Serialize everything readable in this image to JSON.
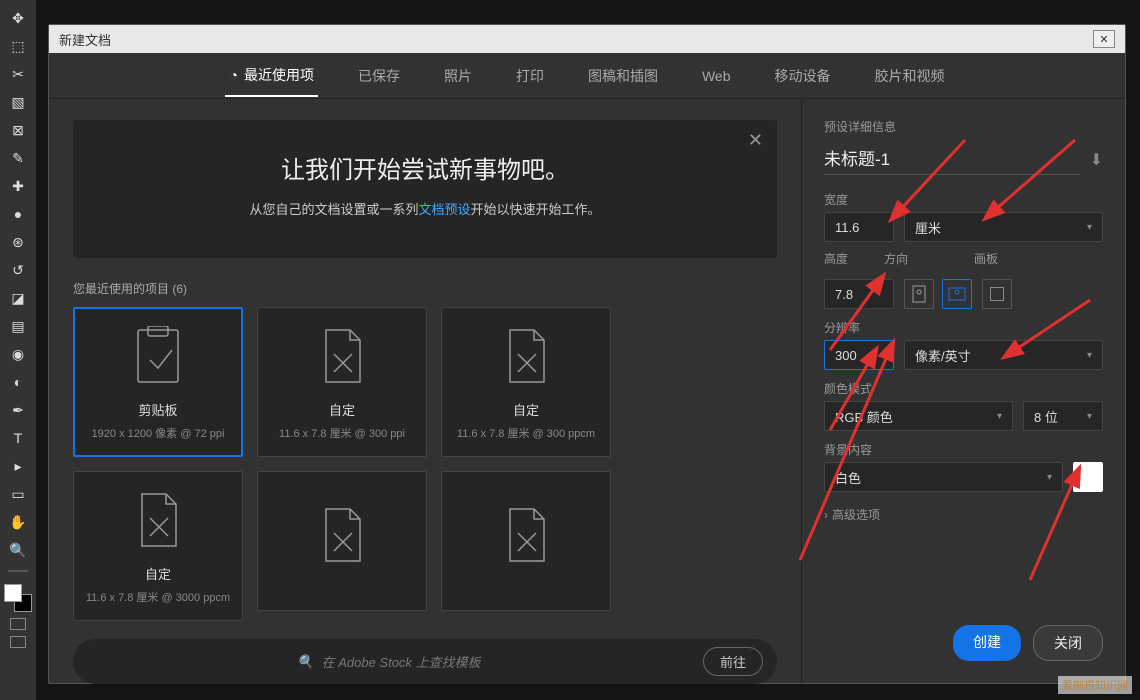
{
  "dialog_title": "新建文档",
  "tabs": [
    "最近使用项",
    "已保存",
    "照片",
    "打印",
    "图稿和插图",
    "Web",
    "移动设备",
    "胶片和视频"
  ],
  "banner": {
    "title": "让我们开始尝试新事物吧。",
    "lead": "从您自己的文档设置或一系列",
    "link": "文档预设",
    "trail": "开始以快速开始工作。"
  },
  "recent_header": "您最近使用的项目 (6)",
  "presets": [
    {
      "name": "剪贴板",
      "meta": "1920 x 1200 像素 @ 72 ppi"
    },
    {
      "name": "自定",
      "meta": "11.6 x 7.8 厘米 @ 300 ppi"
    },
    {
      "name": "自定",
      "meta": "11.6 x 7.8 厘米 @ 300 ppcm"
    },
    {
      "name": "自定",
      "meta": "11.6 x 7.8 厘米 @ 3000 ppcm"
    }
  ],
  "search": {
    "placeholder": "在 Adobe Stock 上查找模板",
    "go": "前往"
  },
  "right": {
    "header": "预设详细信息",
    "docname": "未标题-1",
    "width_lbl": "宽度",
    "width_val": "11.6",
    "width_unit": "厘米",
    "height_lbl": "高度",
    "height_val": "7.8",
    "orient_lbl": "方向",
    "artboard_lbl": "画板",
    "res_lbl": "分辨率",
    "res_val": "300",
    "res_unit": "像素/英寸",
    "mode_lbl": "颜色模式",
    "mode_val": "RGB 颜色",
    "bits": "8 位",
    "bg_lbl": "背景内容",
    "bg_val": "白色",
    "adv": "高级选项"
  },
  "buttons": {
    "create": "创建",
    "close": "关闭"
  },
  "watermark": "爱刨根知识网"
}
